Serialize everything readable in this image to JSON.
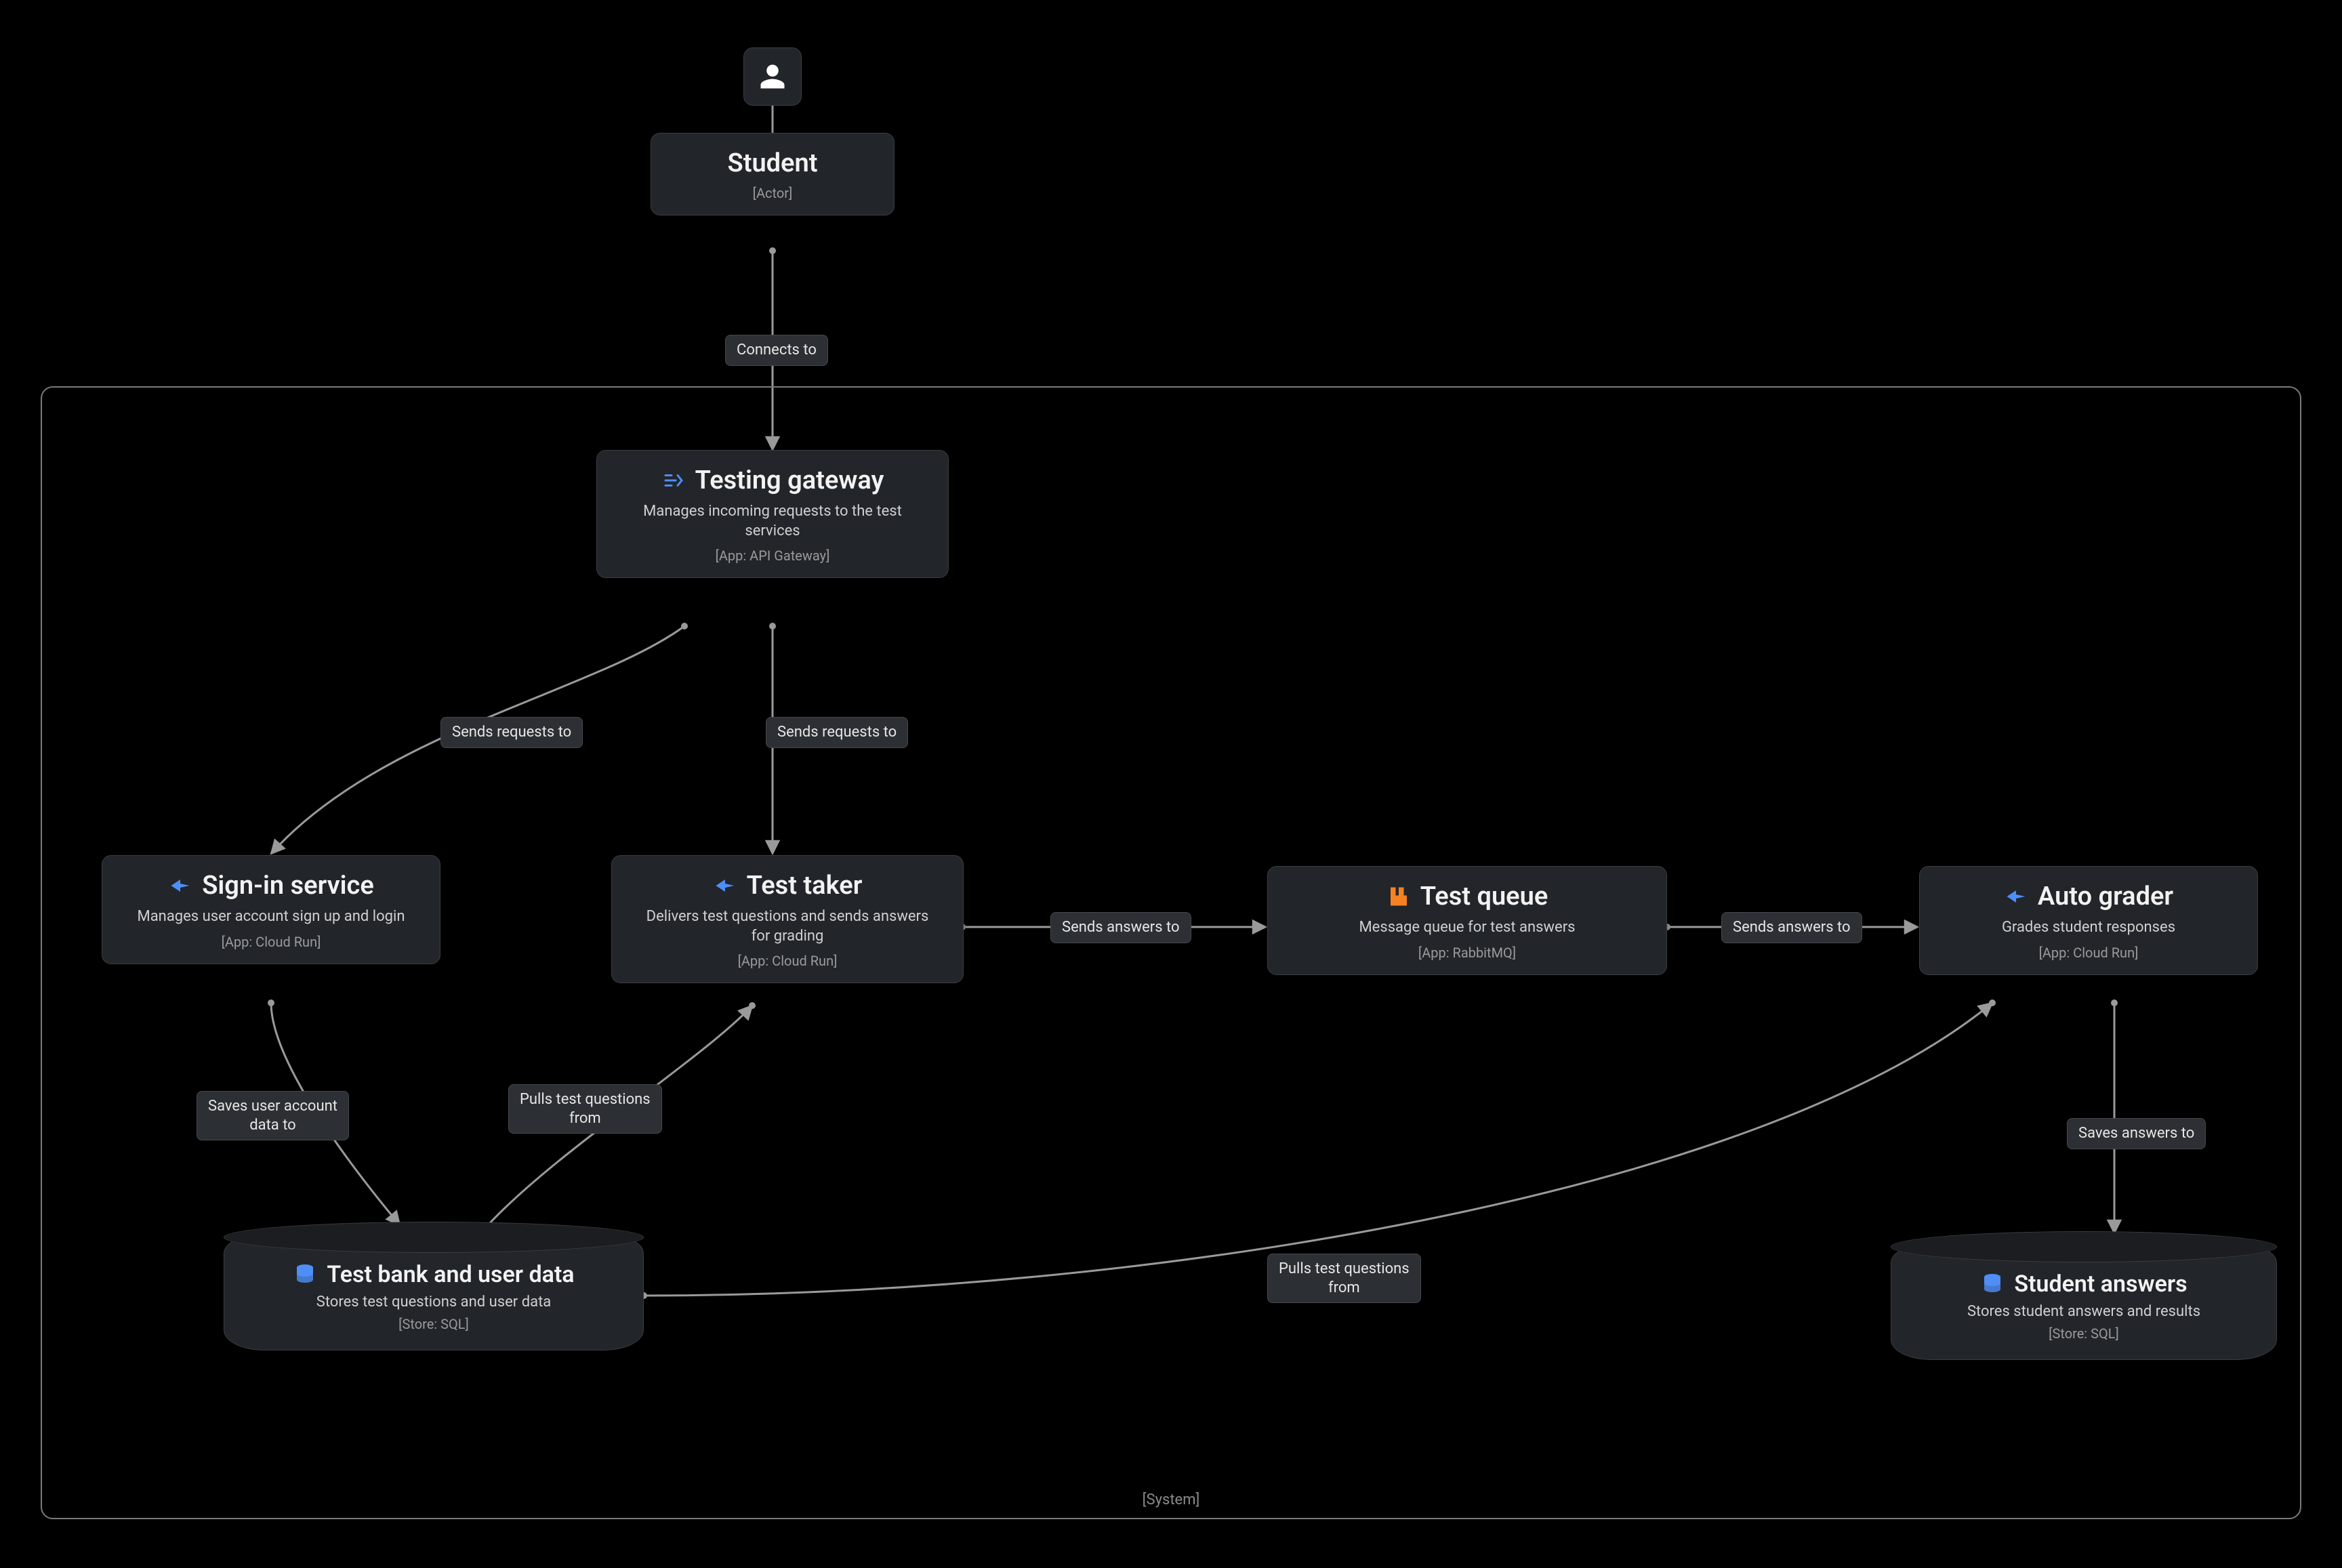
{
  "system": {
    "label": "[System]"
  },
  "actor": {
    "title": "Student",
    "meta": "[Actor]"
  },
  "nodes": {
    "gateway": {
      "title": "Testing gateway",
      "desc": "Manages incoming requests to the test services",
      "meta": "[App: API Gateway]"
    },
    "signin": {
      "title": "Sign-in service",
      "desc": "Manages user account sign up and login",
      "meta": "[App: Cloud Run]"
    },
    "taker": {
      "title": "Test taker",
      "desc": "Delivers test questions and sends answers for grading",
      "meta": "[App: Cloud Run]"
    },
    "queue": {
      "title": "Test queue",
      "desc": "Message queue for test answers",
      "meta": "[App: RabbitMQ]"
    },
    "grader": {
      "title": "Auto grader",
      "desc": "Grades student responses",
      "meta": "[App: Cloud Run]"
    }
  },
  "stores": {
    "bank": {
      "title": "Test bank and user data",
      "desc": "Stores test questions and user data",
      "meta": "[Store: SQL]"
    },
    "answers": {
      "title": "Student answers",
      "desc": "Stores student answers and results",
      "meta": "[Store: SQL]"
    }
  },
  "edges": {
    "connects": "Connects to",
    "req_signin": "Sends requests to",
    "req_taker": "Sends requests to",
    "ans_queue": "Sends answers to",
    "ans_grader": "Sends answers to",
    "save_user": "Saves user account\ndata to",
    "pull_taker": "Pulls test questions\nfrom",
    "pull_grader": "Pulls test questions\nfrom",
    "save_ans": "Saves answers to"
  }
}
